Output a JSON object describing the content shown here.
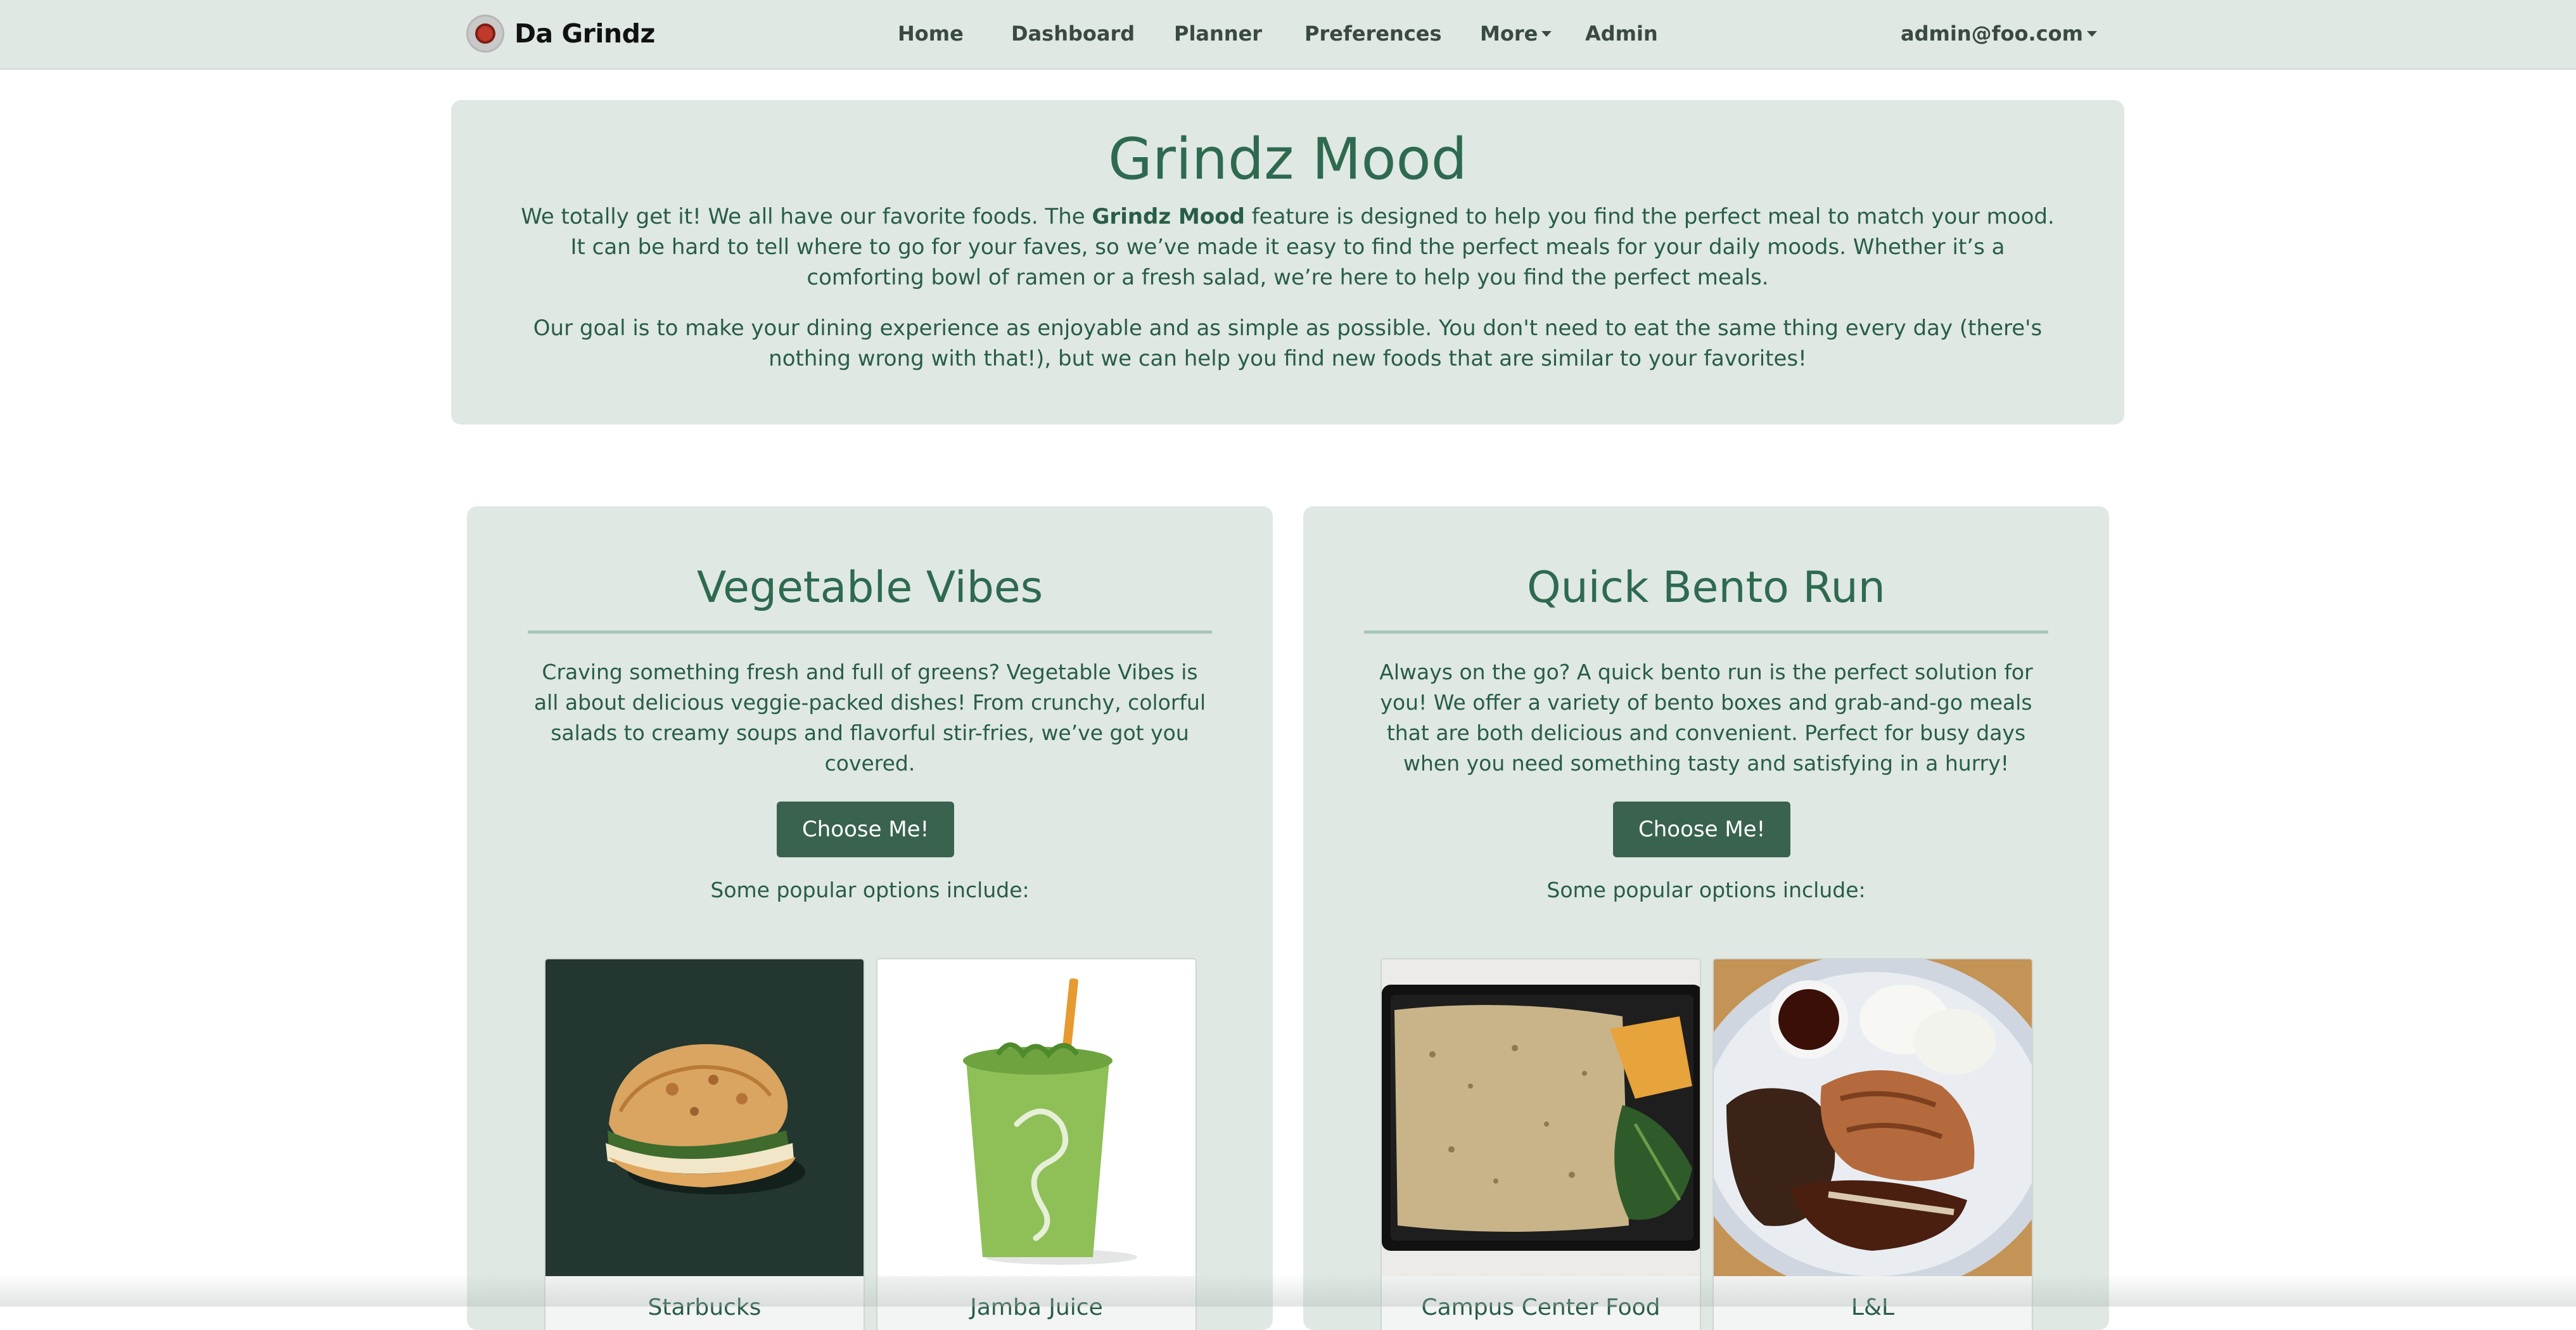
{
  "navbar": {
    "brand": "Da Grindz",
    "links": [
      "Home",
      "Dashboard",
      "Planner",
      "Preferences",
      "More",
      "Admin"
    ],
    "user": "admin@foo.com"
  },
  "hero": {
    "title": "Grindz Mood",
    "p1_before": "We totally get it! We all have our favorite foods. The ",
    "p1_bold": "Grindz Mood",
    "p1_after": " feature is designed to help you find the perfect meal to match your mood. It can be hard to tell where to go for your faves, so we’ve made it easy to find the perfect meals for your daily moods. Whether it’s a comforting bowl of ramen or a fresh salad, we’re here to help you find the perfect meals.",
    "p2": "Our goal is to make your dining experience as enjoyable and as simple as possible. You don't need to eat the same thing every day (there's nothing wrong with that!), but we can help you find new foods that are similar to your favorites!"
  },
  "cards": [
    {
      "title": "Vegetable Vibes",
      "description": "Craving something fresh and full of greens? Vegetable Vibes is all about delicious veggie-packed dishes! From crunchy, colorful salads to creamy soups and flavorful stir-fries, we’ve got you covered.",
      "button": "Choose Me!",
      "popular": "Some popular options include:",
      "options": [
        "Starbucks",
        "Jamba Juice"
      ]
    },
    {
      "title": "Quick Bento Run",
      "description": "Always on the go? A quick bento run is the perfect solution for you! We offer a variety of bento boxes and grab-and-go meals that are both delicious and convenient. Perfect for busy days when you need something tasty and satisfying in a hurry!",
      "button": "Choose Me!",
      "popular": "Some popular options include:",
      "options": [
        "Campus Center Food",
        "L&L"
      ]
    }
  ],
  "colors": {
    "accent": "#2e6a4f",
    "panel": "#dfe8e3",
    "button": "#39634f"
  }
}
